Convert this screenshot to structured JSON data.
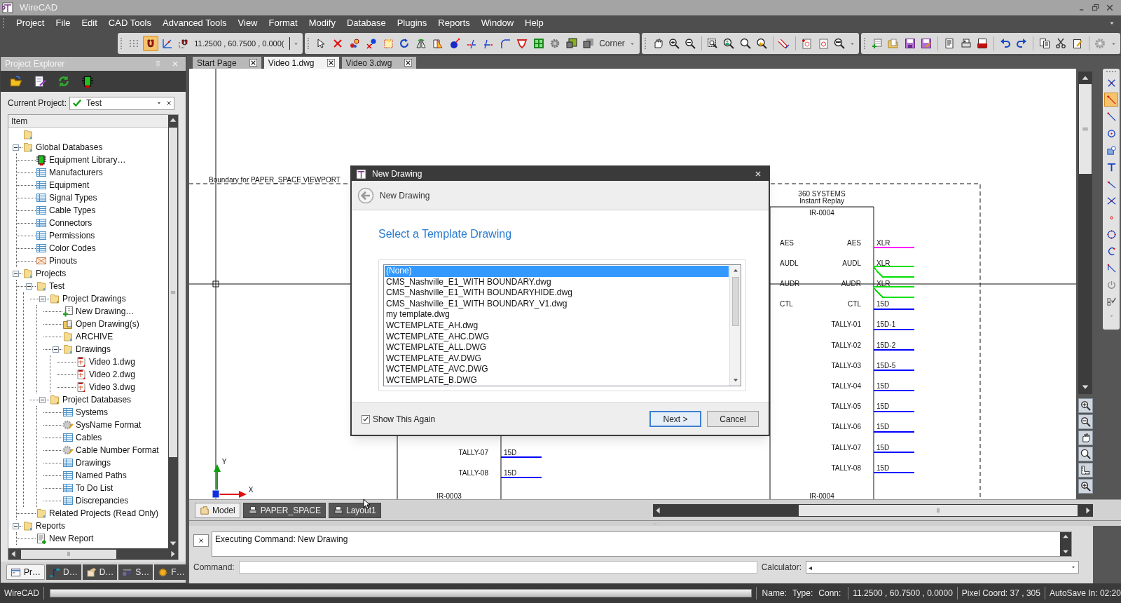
{
  "window": {
    "title": "WireCAD"
  },
  "menu": [
    "Project",
    "File",
    "Edit",
    "CAD Tools",
    "Advanced Tools",
    "View",
    "Format",
    "Modify",
    "Database",
    "Plugins",
    "Reports",
    "Window",
    "Help"
  ],
  "toolbar": {
    "snap_on": true,
    "coordinates": "11.2500 , 60.7500 , 0.000(",
    "snap_mode": "Corner"
  },
  "project_explorer": {
    "title": "Project Explorer",
    "current_project_label": "Current Project:",
    "current_project": "Test",
    "column": "Item",
    "tree": [
      {
        "kind": "folder"
      },
      {
        "kind": "folder",
        "label": "Global Databases",
        "expanded": true,
        "children": [
          {
            "kind": "chip",
            "label": "Equipment Library…"
          },
          {
            "kind": "table",
            "label": "Manufacturers"
          },
          {
            "kind": "table",
            "label": "Equipment"
          },
          {
            "kind": "table",
            "label": "Signal Types"
          },
          {
            "kind": "table",
            "label": "Cable Types"
          },
          {
            "kind": "table",
            "label": "Connectors"
          },
          {
            "kind": "table",
            "label": "Permissions"
          },
          {
            "kind": "table",
            "label": "Color Codes"
          },
          {
            "kind": "pinout",
            "label": "Pinouts"
          }
        ]
      },
      {
        "kind": "folder",
        "label": "Projects",
        "expanded": true,
        "children": [
          {
            "kind": "folder",
            "label": "Test",
            "expanded": true,
            "children": [
              {
                "kind": "folder",
                "label": "Project Drawings",
                "expanded": true,
                "children": [
                  {
                    "kind": "new",
                    "label": "New Drawing…"
                  },
                  {
                    "kind": "open",
                    "label": "Open Drawing(s)"
                  },
                  {
                    "kind": "folder",
                    "label": "ARCHIVE"
                  },
                  {
                    "kind": "folder",
                    "label": "Drawings",
                    "expanded": true,
                    "children": [
                      {
                        "kind": "dwg",
                        "label": "Video 1.dwg"
                      },
                      {
                        "kind": "dwg",
                        "label": "Video 2.dwg"
                      },
                      {
                        "kind": "dwg",
                        "label": "Video 3.dwg"
                      }
                    ]
                  }
                ]
              },
              {
                "kind": "folder",
                "label": "Project Databases",
                "expanded": true,
                "children": [
                  {
                    "kind": "table",
                    "label": "Systems"
                  },
                  {
                    "kind": "format",
                    "label": "SysName Format"
                  },
                  {
                    "kind": "table",
                    "label": "Cables"
                  },
                  {
                    "kind": "format",
                    "label": "Cable Number Format"
                  },
                  {
                    "kind": "table",
                    "label": "Drawings"
                  },
                  {
                    "kind": "table",
                    "label": "Named Paths"
                  },
                  {
                    "kind": "table",
                    "label": "To Do List"
                  },
                  {
                    "kind": "table",
                    "label": "Discrepancies"
                  }
                ]
              }
            ]
          },
          {
            "kind": "folder",
            "label": "Related Projects (Read Only)"
          }
        ]
      },
      {
        "kind": "folder",
        "label": "Reports",
        "expanded": true,
        "children": [
          {
            "kind": "report",
            "label": "New Report"
          }
        ]
      }
    ],
    "tabs": [
      {
        "label": "Pr…",
        "selected": true
      },
      {
        "label": "D…",
        "selected": false
      },
      {
        "label": "D…",
        "selected": false
      },
      {
        "label": "S…",
        "selected": false
      },
      {
        "label": "F…",
        "selected": false
      }
    ]
  },
  "document_tabs": [
    {
      "label": "Start Page",
      "selected": false
    },
    {
      "label": "Video 1.dwg",
      "selected": true
    },
    {
      "label": "Video 3.dwg",
      "selected": false
    }
  ],
  "drawing": {
    "boundary_label": "Boundary for PAPER_SPACE VIEWPORT",
    "axis_y": "Y",
    "axis_x": "X",
    "right_device": {
      "maker": "360 SYSTEMS",
      "model": "Instant Replay",
      "tag": "IR-0004",
      "footer_tag": "IR-0004",
      "pins": [
        {
          "in": "AES",
          "out": "AES",
          "cable": "XLR",
          "color": "#ff00ff",
          "kind": "single"
        },
        {
          "in": "AUDL",
          "out": "AUDL",
          "cable": "XLR",
          "color": "#00e000",
          "kind": "split"
        },
        {
          "in": "AUDR",
          "out": "AUDR",
          "cable": "XLR",
          "color": "#00e000",
          "kind": "split"
        },
        {
          "in": "CTL",
          "out": "CTL",
          "cable": "15D",
          "color": "#0000ff",
          "kind": "single"
        },
        {
          "out": "TALLY-01",
          "cable": "15D-1",
          "color": "#0000ff",
          "kind": "single"
        },
        {
          "out": "TALLY-02",
          "cable": "15D-2",
          "color": "#0000ff",
          "kind": "single"
        },
        {
          "out": "TALLY-03",
          "cable": "15D-5",
          "color": "#0000ff",
          "kind": "single"
        },
        {
          "out": "TALLY-04",
          "cable": "15D",
          "color": "#0000ff",
          "kind": "single"
        },
        {
          "out": "TALLY-05",
          "cable": "15D",
          "color": "#0000ff",
          "kind": "single"
        },
        {
          "out": "TALLY-06",
          "cable": "15D",
          "color": "#0000ff",
          "kind": "single"
        },
        {
          "out": "TALLY-07",
          "cable": "15D",
          "color": "#0000ff",
          "kind": "single"
        },
        {
          "out": "TALLY-08",
          "cable": "15D",
          "color": "#0000ff",
          "kind": "single"
        }
      ]
    },
    "left_device": {
      "footer_tag": "IR-0003",
      "pins": [
        {
          "out": "TALLY-07",
          "cable": "15D",
          "color": "#0000ff",
          "kind": "single"
        },
        {
          "out": "TALLY-08",
          "cable": "15D",
          "color": "#0000ff",
          "kind": "single"
        }
      ]
    }
  },
  "layout_tabs": [
    {
      "label": "Model",
      "selected": true
    },
    {
      "label": "PAPER_SPACE",
      "selected": false
    },
    {
      "label": "Layout1",
      "selected": false
    }
  ],
  "dialog": {
    "title": "New Drawing",
    "nav_title": "New Drawing",
    "heading": "Select a Template Drawing",
    "templates": [
      {
        "label": "(None)",
        "selected": true
      },
      {
        "label": "CMS_Nashville_E1_WITH BOUNDARY.dwg",
        "selected": false
      },
      {
        "label": "CMS_Nashville_E1_WITH BOUNDARYHIDE.dwg",
        "selected": false
      },
      {
        "label": "CMS_Nashville_E1_WITH BOUNDARY_V1.dwg",
        "selected": false
      },
      {
        "label": "my template.dwg",
        "selected": false
      },
      {
        "label": "WCTEMPLATE_AH.dwg",
        "selected": false
      },
      {
        "label": "WCTEMPLATE_AHC.DWG",
        "selected": false
      },
      {
        "label": "WCTEMPLATE_ALL.DWG",
        "selected": false
      },
      {
        "label": "WCTEMPLATE_AV.DWG",
        "selected": false
      },
      {
        "label": "WCTEMPLATE_AVC.DWG",
        "selected": false
      },
      {
        "label": "WCTEMPLATE_B.DWG",
        "selected": false
      }
    ],
    "show_again": {
      "label": "Show This Again",
      "checked": true
    },
    "buttons": [
      {
        "label": "Next >",
        "kind": "default"
      },
      {
        "label": "Cancel",
        "kind": "normal"
      }
    ]
  },
  "command": {
    "output": "Executing Command: New Drawing",
    "command_label": "Command:",
    "calculator_label": "Calculator:",
    "calculator_value": "◂"
  },
  "status_bar": {
    "app": "WireCAD",
    "progress": {
      "level": 0
    },
    "name_label": "Name:",
    "type_label": "Type:",
    "conn_label": "Conn:",
    "coordinates": "11.2500 , 60.7500 , 0.0000",
    "pixel_coord": "Pixel Coord: 37 , 305",
    "autosave": "AutoSave In: 02:20"
  }
}
